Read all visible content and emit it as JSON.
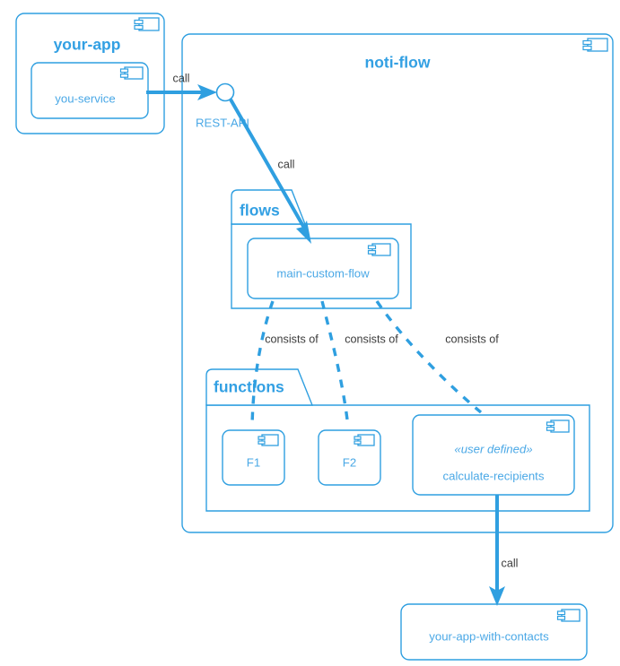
{
  "diagram": {
    "type": "uml-component-diagram",
    "colors": {
      "accent": "#2f9fe0",
      "title_text": "#33a0e3",
      "component_text": "#4aa8e6",
      "edge_label_text": "#3b3b3b",
      "background": "#ffffff"
    }
  },
  "your_app": {
    "title": "your-app",
    "component": {
      "label": "you-service",
      "icon": "component-icon"
    },
    "icon": "component-icon"
  },
  "noti_flow": {
    "title": "noti-flow",
    "icon": "component-icon",
    "interface": {
      "label": "REST-API",
      "icon": "provided-interface-circle"
    },
    "flows_package": {
      "title": "flows",
      "components": [
        {
          "label": "main-custom-flow",
          "icon": "component-icon"
        }
      ]
    },
    "functions_package": {
      "title": "functions",
      "components": [
        {
          "label": "F1",
          "icon": "component-icon"
        },
        {
          "label": "F2",
          "icon": "component-icon"
        },
        {
          "label": "calculate-recipients",
          "stereotype": "«user defined»",
          "icon": "component-icon"
        }
      ]
    }
  },
  "your_app_with_contacts": {
    "label": "your-app-with-contacts",
    "icon": "component-icon"
  },
  "edges": {
    "call_to_rest_api": "call",
    "rest_api_to_flow": "call",
    "consists_of_f1": "consists of",
    "consists_of_f2": "consists of",
    "consists_of_calc": "consists of",
    "calc_to_contacts": "call"
  }
}
